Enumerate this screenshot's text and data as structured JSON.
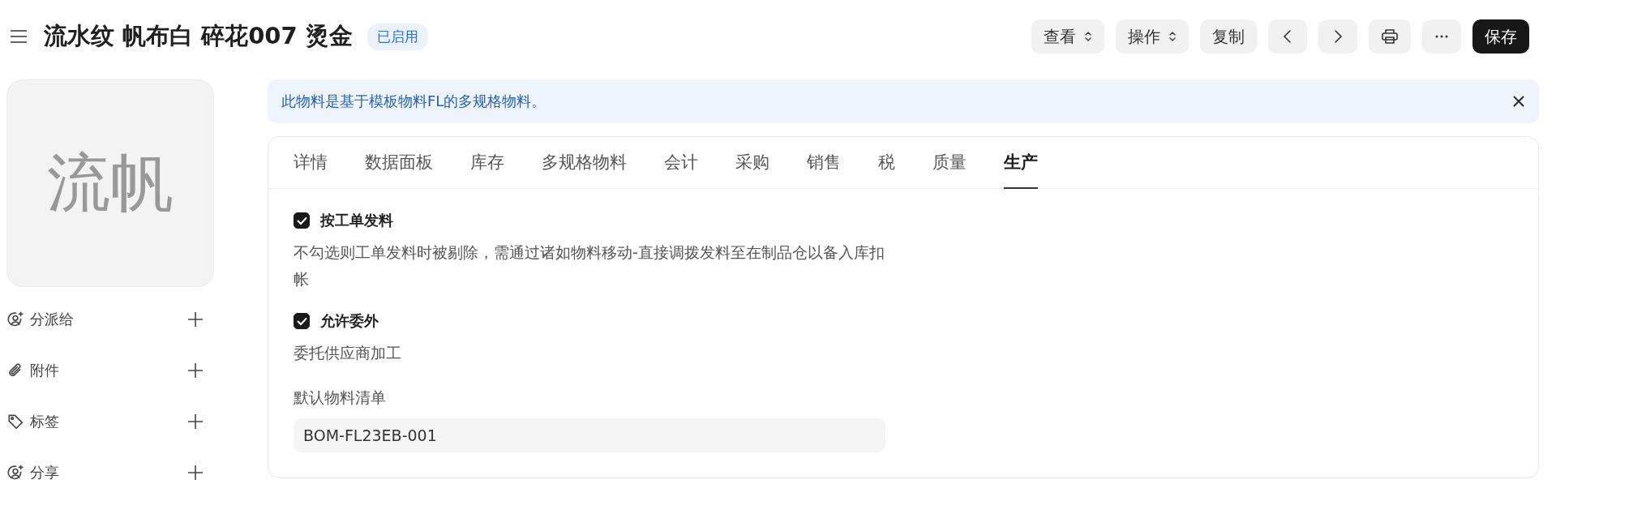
{
  "header": {
    "title": "流水纹 帆布白 碎花007 烫金",
    "status_badge": "已启用",
    "buttons": [
      {
        "kind": "dropdown",
        "label": "查看"
      },
      {
        "kind": "dropdown",
        "label": "操作"
      },
      {
        "kind": "text",
        "label": "复制"
      },
      {
        "kind": "prev"
      },
      {
        "kind": "next"
      },
      {
        "kind": "print"
      },
      {
        "kind": "more"
      },
      {
        "kind": "primary",
        "label": "保存"
      }
    ]
  },
  "sidebar": {
    "avatar_text": "流帆",
    "items": [
      {
        "kind": "assign",
        "label": "分派给"
      },
      {
        "kind": "attach",
        "label": "附件"
      },
      {
        "kind": "tag",
        "label": "标签"
      },
      {
        "kind": "share",
        "label": "分享"
      }
    ]
  },
  "banner": {
    "text": "此物料是基于模板物料FL的多规格物料。"
  },
  "tabs": [
    {
      "label": "详情",
      "selected": false
    },
    {
      "label": "数据面板",
      "selected": false
    },
    {
      "label": "库存",
      "selected": false
    },
    {
      "label": "多规格物料",
      "selected": false
    },
    {
      "label": "会计",
      "selected": false
    },
    {
      "label": "采购",
      "selected": false
    },
    {
      "label": "销售",
      "selected": false
    },
    {
      "label": "税",
      "selected": false
    },
    {
      "label": "质量",
      "selected": false
    },
    {
      "label": "生产",
      "selected": true
    }
  ],
  "fields": [
    {
      "kind": "checkbox",
      "label": "按工单发料",
      "checked": true,
      "description": "不勾选则工单发料时被剔除，需通过诸如物料移动-直接调拨发料至在制品仓以备入库扣帐"
    },
    {
      "kind": "checkbox",
      "label": "允许委外",
      "checked": true,
      "description": "委托供应商加工"
    },
    {
      "kind": "text",
      "label": "默认物料清单",
      "value": "BOM-FL23EB-001"
    }
  ]
}
